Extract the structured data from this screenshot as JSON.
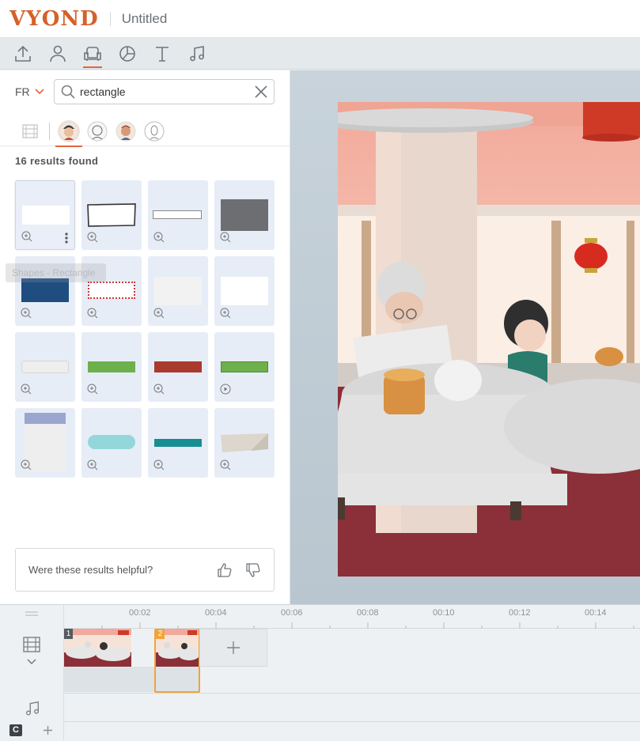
{
  "header": {
    "logo": "VYOND",
    "title": "Untitled"
  },
  "toolbar": {
    "tools": [
      "upload-icon",
      "character-icon",
      "props-icon",
      "chart-icon",
      "text-icon",
      "music-icon"
    ],
    "active_tool": "props-icon"
  },
  "panel": {
    "language": "FR",
    "search_value": "rectangle",
    "results_count": "16 results found",
    "tooltip": "Shapes - Rectangle",
    "feedback_question": "Were these results helpful?"
  },
  "timeline": {
    "ticks": [
      "00:02",
      "00:04",
      "00:06",
      "00:08",
      "00:10",
      "00:12",
      "00:14"
    ],
    "scenes": [
      "1",
      "2"
    ]
  },
  "colors": {
    "accent": "#e5653b",
    "scene_active": "#f0a33c"
  }
}
